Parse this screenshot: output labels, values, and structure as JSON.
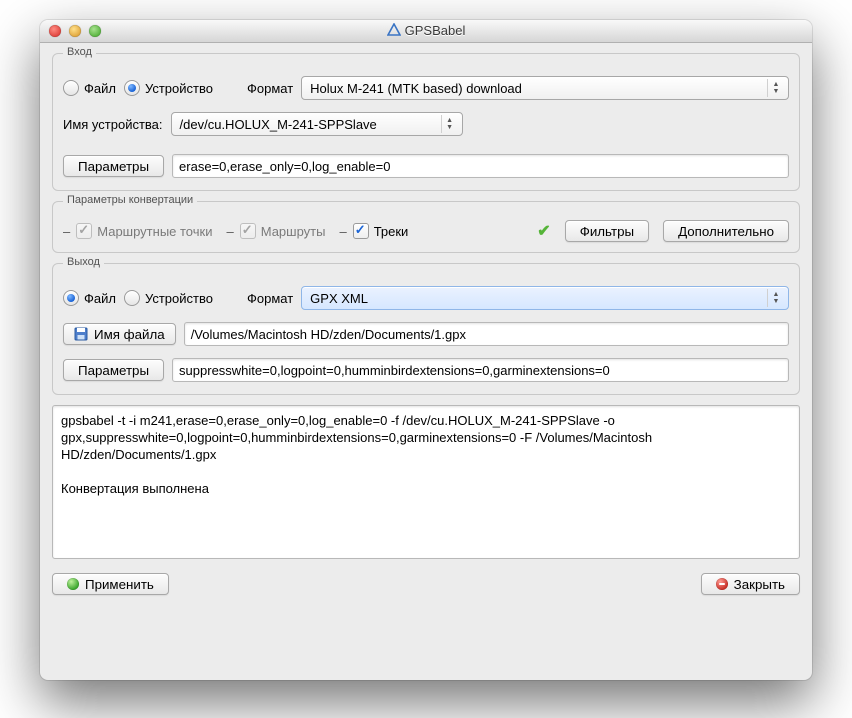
{
  "window": {
    "title": "GPSBabel"
  },
  "input": {
    "group_title": "Вход",
    "radio_file": "Файл",
    "radio_device": "Устройство",
    "format_label": "Формат",
    "format_value": "Holux M-241 (MTK based) download",
    "devname_label": "Имя устройства:",
    "devname_value": "/dev/cu.HOLUX_M-241-SPPSlave",
    "params_btn": "Параметры",
    "params_value": "erase=0,erase_only=0,log_enable=0"
  },
  "convert": {
    "group_title": "Параметры конвертации",
    "waypoints": "Маршрутные точки",
    "routes": "Маршруты",
    "tracks": "Треки",
    "filters_btn": "Фильтры",
    "advanced_btn": "Дополнительно"
  },
  "output": {
    "group_title": "Выход",
    "radio_file": "Файл",
    "radio_device": "Устройство",
    "format_label": "Формат",
    "format_value": "GPX XML",
    "filename_btn": "Имя файла",
    "filename_value": "/Volumes/Macintosh HD/zden/Documents/1.gpx",
    "params_btn": "Параметры",
    "params_value": "suppresswhite=0,logpoint=0,humminbirdextensions=0,garminextensions=0"
  },
  "log": "gpsbabel -t -i m241,erase=0,erase_only=0,log_enable=0 -f /dev/cu.HOLUX_M-241-SPPSlave -o gpx,suppresswhite=0,logpoint=0,humminbirdextensions=0,garminextensions=0 -F /Volumes/Macintosh HD/zden/Documents/1.gpx\n\nКонвертация выполнена",
  "footer": {
    "apply": "Применить",
    "close": "Закрыть"
  }
}
